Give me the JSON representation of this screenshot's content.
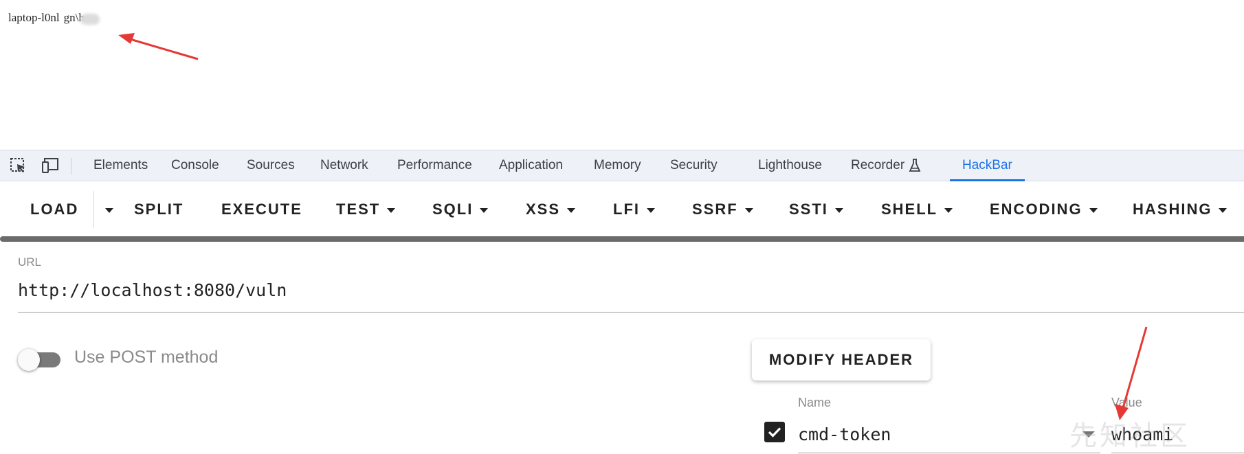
{
  "page": {
    "output_text": "laptop-l0nl",
    "output_suffix": "gn\\h"
  },
  "devtools": {
    "tabs": [
      {
        "label": "Elements"
      },
      {
        "label": "Console"
      },
      {
        "label": "Sources"
      },
      {
        "label": "Network"
      },
      {
        "label": "Performance"
      },
      {
        "label": "Application"
      },
      {
        "label": "Memory"
      },
      {
        "label": "Security"
      },
      {
        "label": "Lighthouse"
      },
      {
        "label": "Recorder"
      },
      {
        "label": "HackBar"
      }
    ],
    "active_tab": "HackBar"
  },
  "hackbar": {
    "toolbar": [
      "LOAD",
      "SPLIT",
      "EXECUTE",
      "TEST",
      "SQLI",
      "XSS",
      "LFI",
      "SSRF",
      "SSTI",
      "SHELL",
      "ENCODING",
      "HASHING"
    ],
    "url_label": "URL",
    "url_value": "http://localhost:8080/vuln",
    "post_toggle_label": "Use POST method",
    "post_enabled": false,
    "modify_header_label": "MODIFY HEADER",
    "header_table": {
      "name_label": "Name",
      "value_label": "Value",
      "rows": [
        {
          "enabled": true,
          "name": "cmd-token",
          "value": "whoami"
        }
      ]
    }
  },
  "watermark": "先知社区",
  "colors": {
    "accent": "#1a73e8",
    "annotation_arrow": "#e53935",
    "toggle_track": "#7a7a7a"
  }
}
